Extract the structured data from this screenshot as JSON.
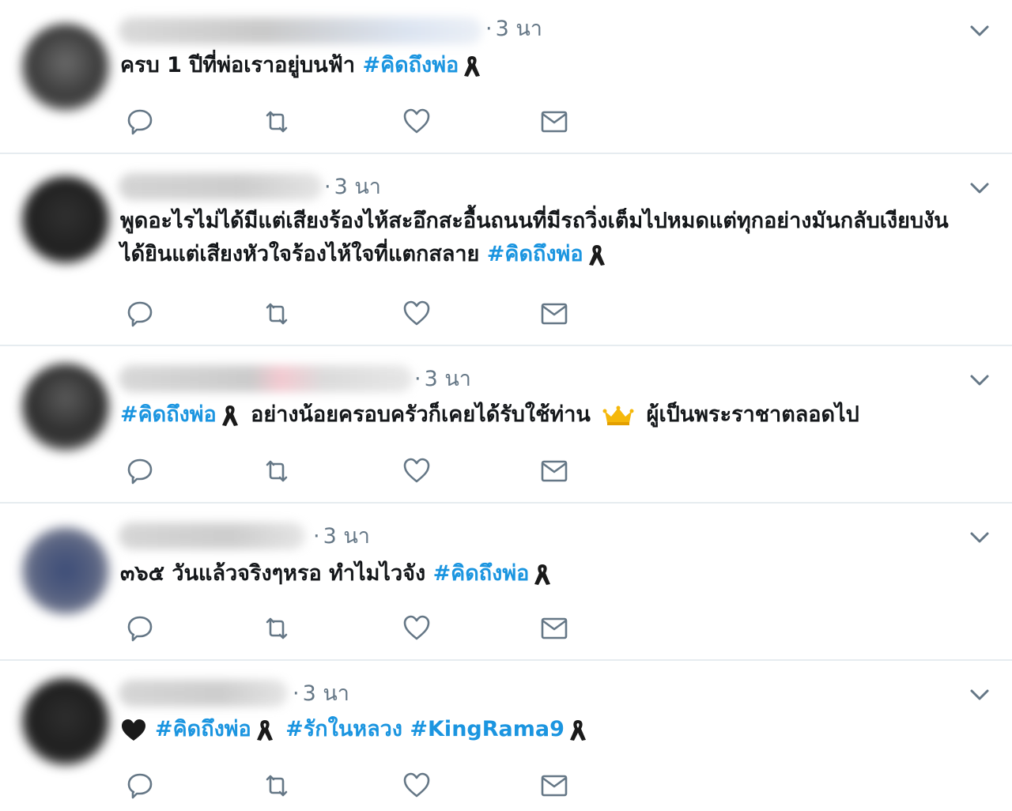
{
  "timeline": {
    "tweets": [
      {
        "time": "3 นา",
        "segments": [
          {
            "type": "text",
            "value": "ครบ 1 ปีที่พ่อเราอยู่บนฟ้า "
          },
          {
            "type": "tag",
            "value": "#คิดถึงพ่อ"
          },
          {
            "type": "ribbon"
          }
        ]
      },
      {
        "time": "3 นา",
        "segments": [
          {
            "type": "text",
            "value": "พูดอะไรไม่ได้มีแต่เสียงร้องไห้สะอึกสะอื้นถนนที่มีรถวิ่งเต็มไปหมดแต่ทุกอย่างมันกลับเงียบงัน ได้ยินแต่เสียงหัวใจร้องไห้ใจที่แตกสลาย "
          },
          {
            "type": "tag",
            "value": "#คิดถึงพ่อ"
          },
          {
            "type": "ribbon"
          }
        ]
      },
      {
        "time": "3 นา",
        "segments": [
          {
            "type": "tag",
            "value": "#คิดถึงพ่อ"
          },
          {
            "type": "ribbon"
          },
          {
            "type": "text",
            "value": " อย่างน้อยครอบครัวก็เคยได้รับใช้ท่าน "
          },
          {
            "type": "crown"
          },
          {
            "type": "text",
            "value": " ผู้เป็นพระราชาตลอดไป"
          }
        ]
      },
      {
        "time": "3 นา",
        "segments": [
          {
            "type": "text",
            "value": "๓๖๕ วันแล้วจริงๆหรอ ทำไมไวจัง "
          },
          {
            "type": "tag",
            "value": "#คิดถึงพ่อ"
          },
          {
            "type": "ribbon"
          }
        ]
      },
      {
        "time": "3 นา",
        "segments": [
          {
            "type": "heart"
          },
          {
            "type": "tag",
            "value": "#คิดถึงพ่อ"
          },
          {
            "type": "ribbon"
          },
          {
            "type": "text",
            "value": " "
          },
          {
            "type": "tag",
            "value": "#รักในหลวง"
          },
          {
            "type": "text",
            "value": " "
          },
          {
            "type": "tag",
            "value": "#KingRama9"
          },
          {
            "type": "ribbon"
          }
        ]
      }
    ]
  },
  "icons": {
    "reply": "reply-icon",
    "retweet": "retweet-icon",
    "like": "like-icon",
    "dm": "direct-message-icon",
    "caret": "chevron-down-icon",
    "ribbon": "black-ribbon-emoji",
    "crown": "crown-emoji",
    "heart": "black-heart-emoji"
  },
  "colors": {
    "hashtag": "#1b95e0",
    "meta": "#657786",
    "divider": "#e6ecf0",
    "icon": "#657786"
  }
}
